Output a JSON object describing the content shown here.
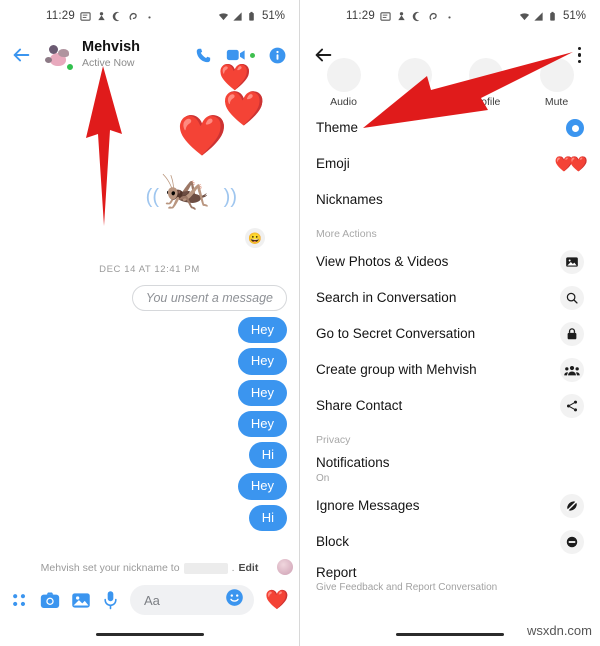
{
  "status_bar": {
    "time": "11:29",
    "battery_percent": "51%",
    "icons": [
      "news-icon",
      "person-icon",
      "moon-icon",
      "swirl-icon",
      "dot-icon",
      "wifi-icon",
      "signal-icon",
      "battery-icon"
    ]
  },
  "left_panel": {
    "header": {
      "back": "back-arrow-icon",
      "name": "Mehvish",
      "status": "Active Now",
      "call": "phone-icon",
      "video": "video-camera-icon",
      "info": "info-circle-icon"
    },
    "chat": {
      "emojis": {
        "heart1": "❤️",
        "heart2": "❤️",
        "heart3": "❤️",
        "cricket": "🦗",
        "wave_left": "((",
        "wave_right": "))",
        "reaction": "😀"
      },
      "date_separator": "DEC 14 AT 12:41 PM",
      "unsent_text": "You unsent a message",
      "messages": [
        {
          "text": "Hey",
          "side": "out"
        },
        {
          "text": "Hey",
          "side": "out"
        },
        {
          "text": "Hey",
          "side": "out"
        },
        {
          "text": "Hey",
          "side": "out"
        },
        {
          "text": "Hi",
          "side": "out"
        },
        {
          "text": "Hey",
          "side": "out"
        },
        {
          "text": "Hi",
          "side": "out"
        }
      ]
    },
    "nickname_banner": {
      "text": "Mehvish set your nickname to",
      "suffix": ".",
      "edit_label": "Edit"
    },
    "composer": {
      "grid": "apps-grid-icon",
      "camera": "camera-icon",
      "gallery": "gallery-icon",
      "mic": "microphone-icon",
      "placeholder": "Aa",
      "emoji": "smiley-icon",
      "like": "❤️"
    }
  },
  "right_panel": {
    "header": {
      "back": "back-arrow-icon",
      "menu": "kebab-menu-icon"
    },
    "tabs": [
      {
        "label": "Audio",
        "icon": "phone-icon"
      },
      {
        "label": "Video",
        "icon": "video-camera-icon"
      },
      {
        "label": "Profile",
        "icon": "person-icon"
      },
      {
        "label": "Mute",
        "icon": "bell-off-icon"
      }
    ],
    "top_items": [
      {
        "label": "Theme",
        "icon": "theme-color-dot",
        "sub": ""
      },
      {
        "label": "Emoji",
        "icon": "hearts-emoji",
        "sub": ""
      },
      {
        "label": "Nicknames",
        "icon": "",
        "sub": ""
      }
    ],
    "more_actions_header": "More Actions",
    "more_actions": [
      {
        "label": "View Photos & Videos",
        "icon": "photo-icon"
      },
      {
        "label": "Search in Conversation",
        "icon": "search-icon"
      },
      {
        "label": "Go to Secret Conversation",
        "icon": "lock-icon"
      },
      {
        "label": "Create group with Mehvish",
        "icon": "group-icon"
      },
      {
        "label": "Share Contact",
        "icon": "share-icon"
      }
    ],
    "privacy_header": "Privacy",
    "privacy_items": [
      {
        "label": "Notifications",
        "sub": "On",
        "icon": ""
      },
      {
        "label": "Ignore Messages",
        "sub": "",
        "icon": "ignore-icon"
      },
      {
        "label": "Block",
        "sub": "",
        "icon": "block-icon"
      },
      {
        "label": "Report",
        "sub": "Give Feedback and Report Conversation",
        "icon": ""
      }
    ]
  },
  "annotations": {
    "arrow_color": "#e01b1b",
    "left_arrow_target": "chat-header-name",
    "right_arrow_target": "block-row"
  },
  "watermark": "wsxdn.com"
}
